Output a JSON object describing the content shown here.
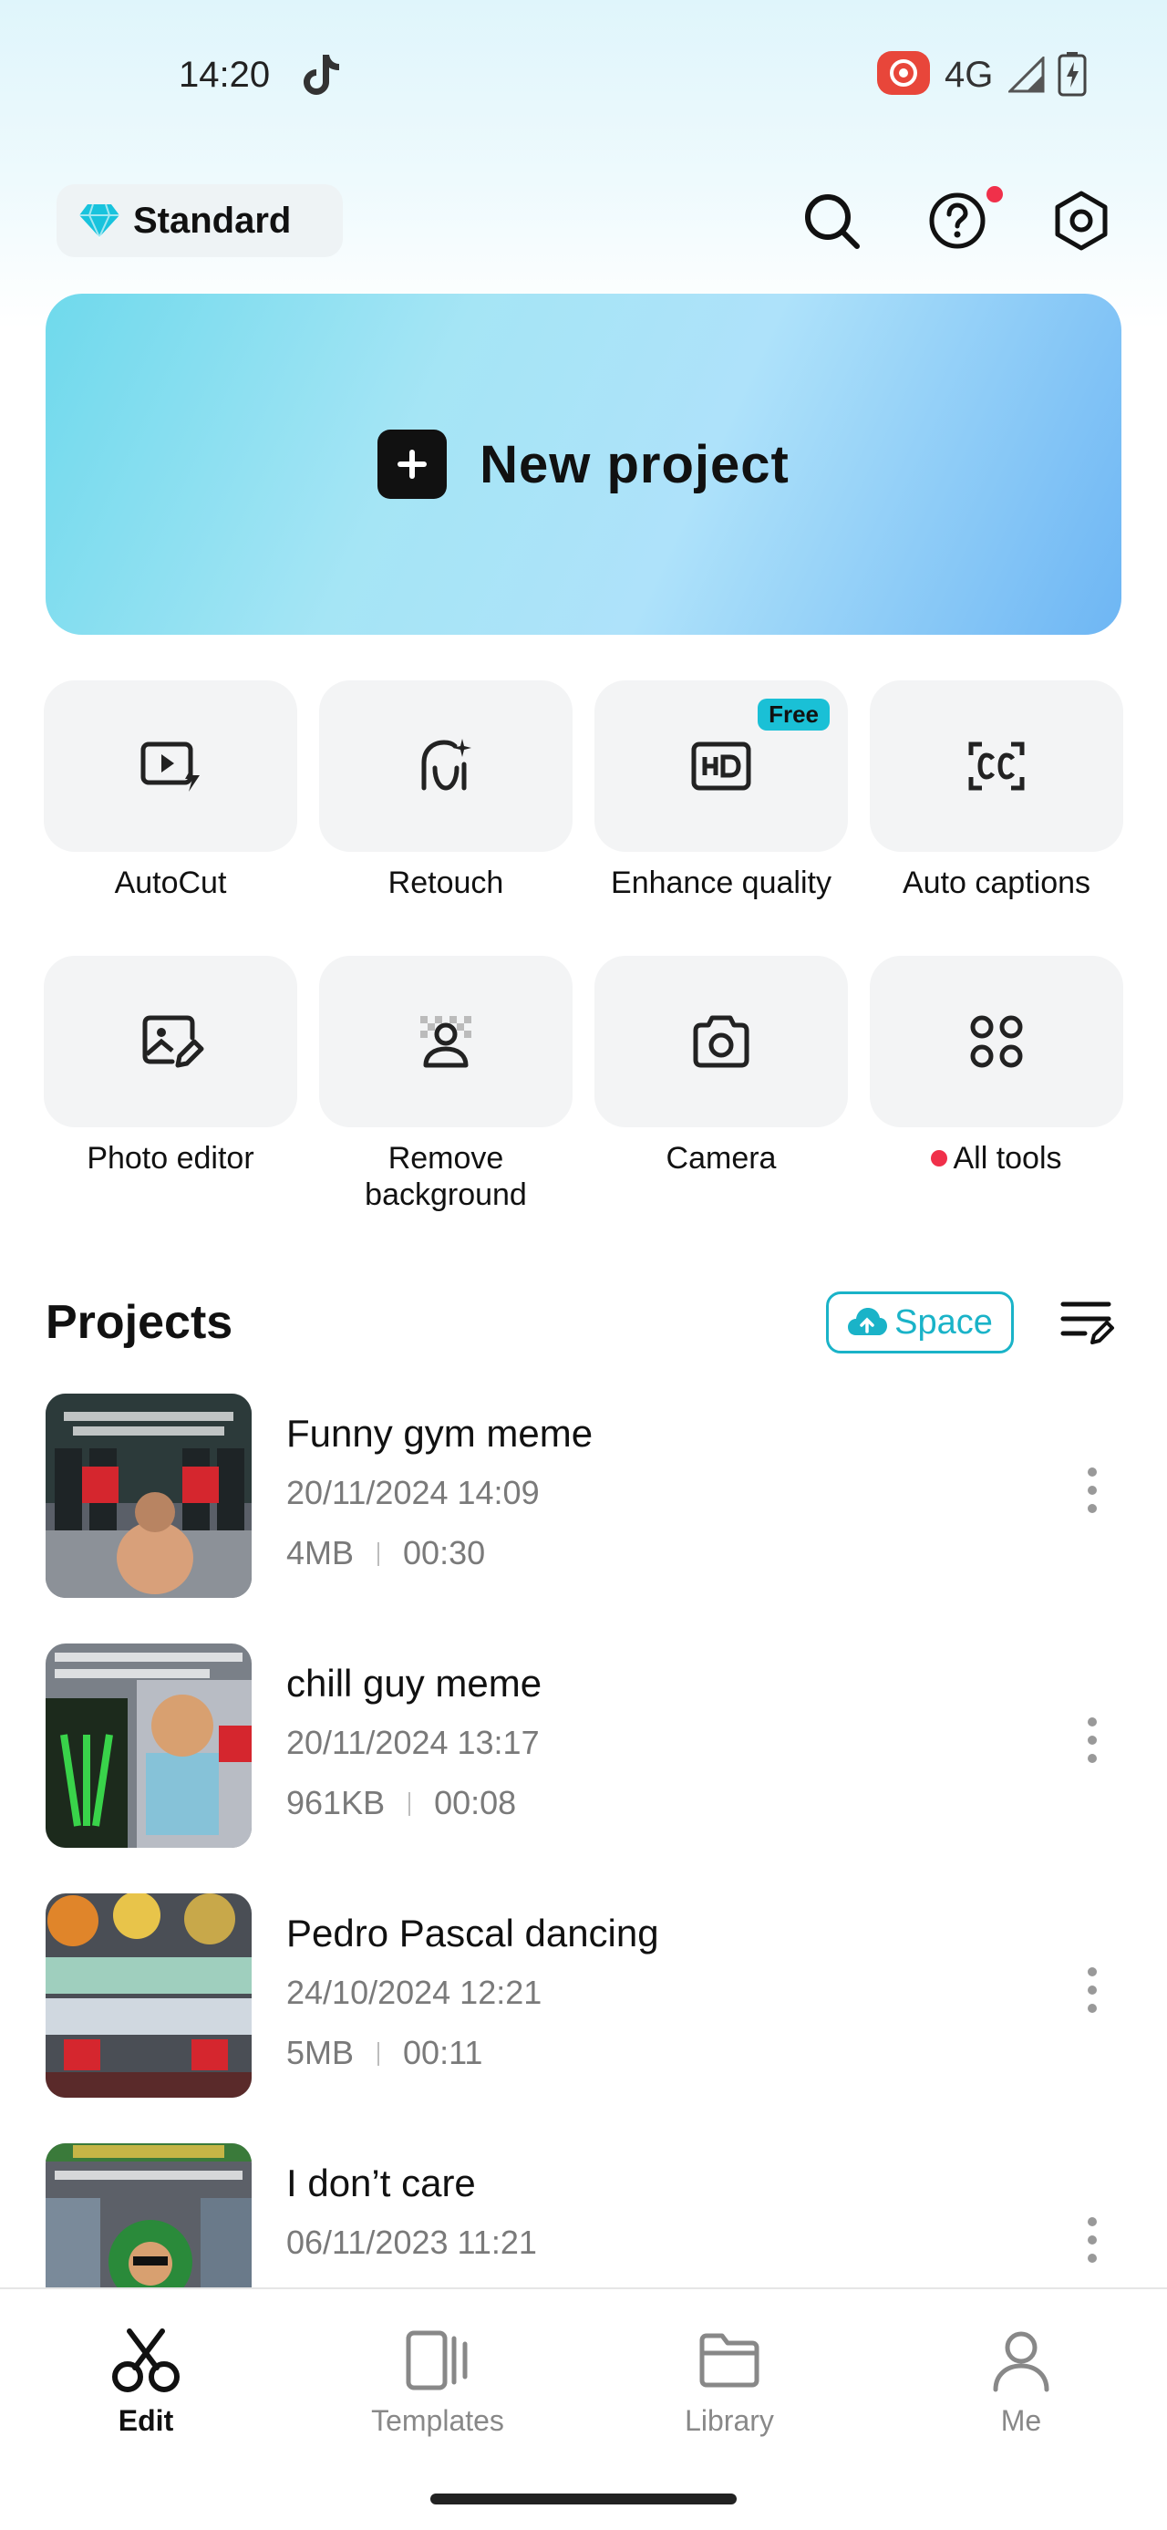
{
  "status_bar": {
    "time": "14:20",
    "network": "4G"
  },
  "header": {
    "plan_label": "Standard"
  },
  "new_project": {
    "label": "New project"
  },
  "tools": [
    {
      "label": "AutoCut",
      "icon": "autocut-icon"
    },
    {
      "label": "Retouch",
      "icon": "retouch-icon"
    },
    {
      "label": "Enhance quality",
      "icon": "hd-icon",
      "badge": "Free"
    },
    {
      "label": "Auto captions",
      "icon": "captions-icon"
    },
    {
      "label": "Photo editor",
      "icon": "photo-edit-icon"
    },
    {
      "label": "Remove background",
      "icon": "remove-bg-icon"
    },
    {
      "label": "Camera",
      "icon": "camera-icon"
    },
    {
      "label": "All tools",
      "icon": "grid-icon"
    }
  ],
  "projects": {
    "title": "Projects",
    "space_label": "Space",
    "items": [
      {
        "title": "Funny gym meme",
        "date": "20/11/2024 14:09",
        "size": "4MB",
        "duration": "00:30"
      },
      {
        "title": "chill guy meme",
        "date": "20/11/2024 13:17",
        "size": "961KB",
        "duration": "00:08"
      },
      {
        "title": "Pedro Pascal dancing",
        "date": "24/10/2024 12:21",
        "size": "5MB",
        "duration": "00:11"
      },
      {
        "title": "I don’t care",
        "date": "06/11/2023 11:21",
        "size": "",
        "duration": ""
      }
    ]
  },
  "bottom_nav": [
    {
      "label": "Edit",
      "active": true
    },
    {
      "label": "Templates",
      "active": false
    },
    {
      "label": "Library",
      "active": false
    },
    {
      "label": "Me",
      "active": false
    }
  ],
  "colors": {
    "accent": "#1ab3c8",
    "notification": "#f0304a"
  }
}
